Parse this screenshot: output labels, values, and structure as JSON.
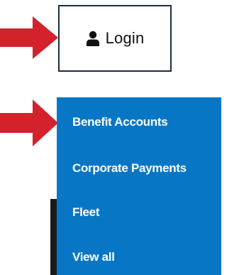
{
  "login": {
    "label": "Login",
    "icon": "user-icon"
  },
  "menu": {
    "items": [
      {
        "label": "Benefit Accounts"
      },
      {
        "label": "Corporate Payments"
      },
      {
        "label": "Fleet"
      },
      {
        "label": "View all"
      }
    ]
  },
  "colors": {
    "arrow": "#d3222c",
    "menu_bg": "#0777c5",
    "login_border": "#1f2d3d"
  }
}
